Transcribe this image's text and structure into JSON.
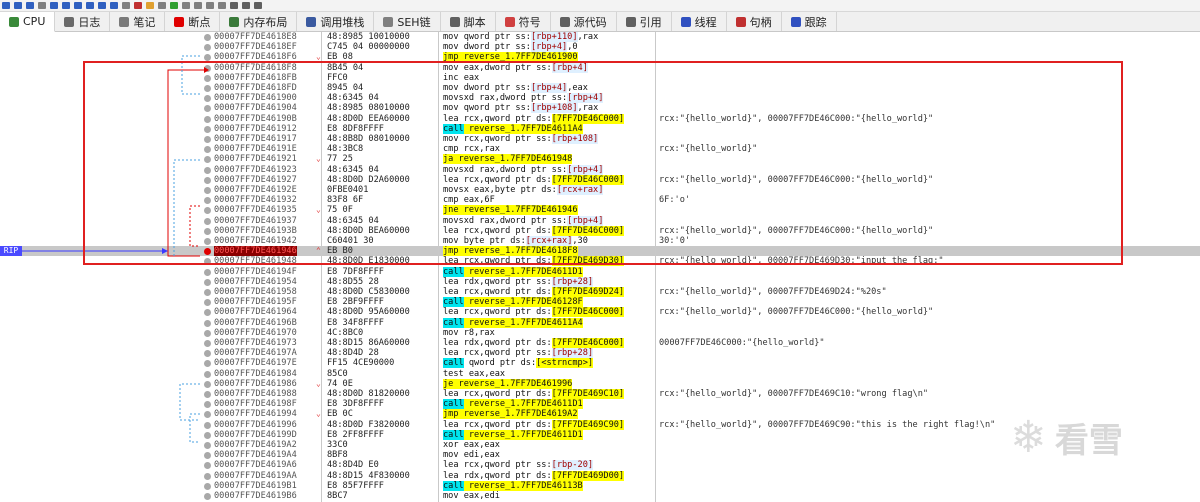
{
  "tabs": [
    {
      "label": "CPU",
      "icon": "cpu-icon",
      "active": true,
      "color": "#3a8a3a"
    },
    {
      "label": "日志",
      "icon": "log-icon",
      "active": false,
      "color": "#6a6a6a"
    },
    {
      "label": "笔记",
      "icon": "notes-icon",
      "active": false,
      "color": "#7a7a7a"
    },
    {
      "label": "断点",
      "icon": "breakpoint-icon",
      "active": false,
      "color": "#e00000"
    },
    {
      "label": "内存布局",
      "icon": "memory-map-icon",
      "active": false,
      "color": "#3a7a3a"
    },
    {
      "label": "调用堆栈",
      "icon": "call-stack-icon",
      "active": false,
      "color": "#3a5aa0"
    },
    {
      "label": "SEH链",
      "icon": "seh-icon",
      "active": false,
      "color": "#808080"
    },
    {
      "label": "脚本",
      "icon": "script-icon",
      "active": false,
      "color": "#606060"
    },
    {
      "label": "符号",
      "icon": "symbol-icon",
      "active": false,
      "color": "#d04040"
    },
    {
      "label": "源代码",
      "icon": "source-icon",
      "active": false,
      "color": "#606060"
    },
    {
      "label": "引用",
      "icon": "reference-icon",
      "active": false,
      "color": "#606060"
    },
    {
      "label": "线程",
      "icon": "thread-icon",
      "active": false,
      "color": "#3050c0"
    },
    {
      "label": "句柄",
      "icon": "handle-icon",
      "active": false,
      "color": "#c03030"
    },
    {
      "label": "跟踪",
      "icon": "trace-icon",
      "active": false,
      "color": "#3050c0"
    }
  ],
  "rip_label": "RIP",
  "watermark": "看雪",
  "rows": [
    {
      "addr": "00007FF7DE4618E8",
      "bytes": "48:8985 10010000",
      "instr": [
        {
          "t": "mov qword ptr ss:"
        },
        {
          "t": "[rbp+110]",
          "c": "mem"
        },
        {
          "t": ",rax"
        }
      ],
      "comment": ""
    },
    {
      "addr": "00007FF7DE4618EF",
      "bytes": "C745 04 00000000",
      "instr": [
        {
          "t": "mov dword ptr ss:"
        },
        {
          "t": "[rbp+4]",
          "c": "mem"
        },
        {
          "t": ",0"
        }
      ],
      "comment": ""
    },
    {
      "addr": "00007FF7DE4618F6",
      "bytes": "EB 08",
      "arrow": "v",
      "instr": [
        {
          "t": "jmp reverse_1.7FF7DE461900",
          "c": "hl-y"
        }
      ],
      "comment": ""
    },
    {
      "addr": "00007FF7DE4618F8",
      "bytes": "8B45 04",
      "instr": [
        {
          "t": "mov eax,dword ptr ss:"
        },
        {
          "t": "[rbp+4]",
          "c": "mem"
        }
      ],
      "comment": ""
    },
    {
      "addr": "00007FF7DE4618FB",
      "bytes": "FFC0",
      "instr": [
        {
          "t": "inc eax"
        }
      ],
      "comment": ""
    },
    {
      "addr": "00007FF7DE4618FD",
      "bytes": "8945 04",
      "instr": [
        {
          "t": "mov dword ptr ss:"
        },
        {
          "t": "[rbp+4]",
          "c": "mem"
        },
        {
          "t": ",eax"
        }
      ],
      "comment": ""
    },
    {
      "addr": "00007FF7DE461900",
      "bytes": "48:6345 04",
      "instr": [
        {
          "t": "movsxd rax,dword ptr ss:"
        },
        {
          "t": "[rbp+4]",
          "c": "mem"
        }
      ],
      "comment": ""
    },
    {
      "addr": "00007FF7DE461904",
      "bytes": "48:8985 08010000",
      "instr": [
        {
          "t": "mov qword ptr ss:"
        },
        {
          "t": "[rbp+108]",
          "c": "mem"
        },
        {
          "t": ",rax"
        }
      ],
      "comment": ""
    },
    {
      "addr": "00007FF7DE46190B",
      "bytes": "48:8D0D EEA60000",
      "instr": [
        {
          "t": "lea rcx,qword ptr ds:"
        },
        {
          "t": "[7FF7DE46C000]",
          "c": "hl-y"
        }
      ],
      "comment": "rcx:\"{hello_world}\", 00007FF7DE46C000:\"{hello_world}\""
    },
    {
      "addr": "00007FF7DE461912",
      "bytes": "E8 8DF8FFFF",
      "instr": [
        {
          "t": "call",
          "c": "hl-c"
        },
        {
          "t": " reverse_1.7FF7DE4611A4",
          "c": "hl-y"
        }
      ],
      "comment": ""
    },
    {
      "addr": "00007FF7DE461917",
      "bytes": "48:8B8D 08010000",
      "instr": [
        {
          "t": "mov rcx,qword ptr ss:"
        },
        {
          "t": "[rbp+108]",
          "c": "mem"
        }
      ],
      "comment": ""
    },
    {
      "addr": "00007FF7DE46191E",
      "bytes": "48:3BC8",
      "instr": [
        {
          "t": "cmp rcx,rax"
        }
      ],
      "comment": "rcx:\"{hello_world}\""
    },
    {
      "addr": "00007FF7DE461921",
      "bytes": "77 25",
      "arrow": "v",
      "instr": [
        {
          "t": "ja reverse_1.7FF7DE461948",
          "c": "hl-y"
        }
      ],
      "comment": ""
    },
    {
      "addr": "00007FF7DE461923",
      "bytes": "48:6345 04",
      "instr": [
        {
          "t": "movsxd rax,dword ptr ss:"
        },
        {
          "t": "[rbp+4]",
          "c": "mem"
        }
      ],
      "comment": ""
    },
    {
      "addr": "00007FF7DE461927",
      "bytes": "48:8D0D D2A60000",
      "instr": [
        {
          "t": "lea rcx,qword ptr ds:"
        },
        {
          "t": "[7FF7DE46C000]",
          "c": "hl-y"
        }
      ],
      "comment": "rcx:\"{hello_world}\", 00007FF7DE46C000:\"{hello_world}\""
    },
    {
      "addr": "00007FF7DE46192E",
      "bytes": "0FBE0401",
      "instr": [
        {
          "t": "movsx eax,byte ptr ds:"
        },
        {
          "t": "[rcx+rax]",
          "c": "mem"
        }
      ],
      "comment": ""
    },
    {
      "addr": "00007FF7DE461932",
      "bytes": "83F8 6F",
      "instr": [
        {
          "t": "cmp eax,6F"
        }
      ],
      "comment": "6F:'o'"
    },
    {
      "addr": "00007FF7DE461935",
      "bytes": "75 0F",
      "arrow": "v",
      "instr": [
        {
          "t": "jne reverse_1.7FF7DE461946",
          "c": "hl-y"
        }
      ],
      "comment": ""
    },
    {
      "addr": "00007FF7DE461937",
      "bytes": "48:6345 04",
      "instr": [
        {
          "t": "movsxd rax,dword ptr ss:"
        },
        {
          "t": "[rbp+4]",
          "c": "mem"
        }
      ],
      "comment": ""
    },
    {
      "addr": "00007FF7DE46193B",
      "bytes": "48:8D0D BEA60000",
      "instr": [
        {
          "t": "lea rcx,qword ptr ds:"
        },
        {
          "t": "[7FF7DE46C000]",
          "c": "hl-y"
        }
      ],
      "comment": "rcx:\"{hello_world}\", 00007FF7DE46C000:\"{hello_world}\""
    },
    {
      "addr": "00007FF7DE461942",
      "bytes": "C60401 30",
      "instr": [
        {
          "t": "mov byte ptr ds:"
        },
        {
          "t": "[rcx+rax]",
          "c": "mem"
        },
        {
          "t": ",30"
        }
      ],
      "comment": "30:'0'"
    },
    {
      "addr": "00007FF7DE461946",
      "bytes": "EB B0",
      "rip": true,
      "bp": true,
      "arrow": "^",
      "instr": [
        {
          "t": "jmp reverse_1.7FF7DE4618F8",
          "c": "hl-y"
        }
      ],
      "comment": ""
    },
    {
      "addr": "00007FF7DE461948",
      "bytes": "48:8D0D E1830000",
      "instr": [
        {
          "t": "lea rcx,qword ptr ds:"
        },
        {
          "t": "[7FF7DE469D30]",
          "c": "hl-y"
        }
      ],
      "comment": "rcx:\"{hello_world}\", 00007FF7DE469D30:\"input the flag:\""
    },
    {
      "addr": "00007FF7DE46194F",
      "bytes": "E8 7DF8FFFF",
      "instr": [
        {
          "t": "call",
          "c": "hl-c"
        },
        {
          "t": " reverse_1.7FF7DE4611D1",
          "c": "hl-y"
        }
      ],
      "comment": ""
    },
    {
      "addr": "00007FF7DE461954",
      "bytes": "48:8D55 28",
      "instr": [
        {
          "t": "lea rdx,qword ptr ss:"
        },
        {
          "t": "[rbp+28]",
          "c": "mem"
        }
      ],
      "comment": ""
    },
    {
      "addr": "00007FF7DE461958",
      "bytes": "48:8D0D C5830000",
      "instr": [
        {
          "t": "lea rcx,qword ptr ds:"
        },
        {
          "t": "[7FF7DE469D24]",
          "c": "hl-y"
        }
      ],
      "comment": "rcx:\"{hello_world}\", 00007FF7DE469D24:\"%20s\""
    },
    {
      "addr": "00007FF7DE46195F",
      "bytes": "E8 2BF9FFFF",
      "instr": [
        {
          "t": "call",
          "c": "hl-c"
        },
        {
          "t": " reverse_1.7FF7DE46128F",
          "c": "hl-y"
        }
      ],
      "comment": ""
    },
    {
      "addr": "00007FF7DE461964",
      "bytes": "48:8D0D 95A60000",
      "instr": [
        {
          "t": "lea rcx,qword ptr ds:"
        },
        {
          "t": "[7FF7DE46C000]",
          "c": "hl-y"
        }
      ],
      "comment": "rcx:\"{hello_world}\", 00007FF7DE46C000:\"{hello_world}\""
    },
    {
      "addr": "00007FF7DE46196B",
      "bytes": "E8 34F8FFFF",
      "instr": [
        {
          "t": "call",
          "c": "hl-c"
        },
        {
          "t": " reverse_1.7FF7DE4611A4",
          "c": "hl-y"
        }
      ],
      "comment": ""
    },
    {
      "addr": "00007FF7DE461970",
      "bytes": "4C:8BC0",
      "instr": [
        {
          "t": "mov r8,rax"
        }
      ],
      "comment": ""
    },
    {
      "addr": "00007FF7DE461973",
      "bytes": "48:8D15 86A60000",
      "instr": [
        {
          "t": "lea rdx,qword ptr ds:"
        },
        {
          "t": "[7FF7DE46C000]",
          "c": "hl-y"
        }
      ],
      "comment": "00007FF7DE46C000:\"{hello_world}\""
    },
    {
      "addr": "00007FF7DE46197A",
      "bytes": "48:8D4D 28",
      "instr": [
        {
          "t": "lea rcx,qword ptr ss:"
        },
        {
          "t": "[rbp+28]",
          "c": "mem"
        }
      ],
      "comment": ""
    },
    {
      "addr": "00007FF7DE46197E",
      "bytes": "FF15 4CE90000",
      "instr": [
        {
          "t": "call",
          "c": "hl-c"
        },
        {
          "t": " qword ptr ds:"
        },
        {
          "t": "[<strncmp>]",
          "c": "hl-y"
        }
      ],
      "comment": ""
    },
    {
      "addr": "00007FF7DE461984",
      "bytes": "85C0",
      "instr": [
        {
          "t": "test eax,eax"
        }
      ],
      "comment": ""
    },
    {
      "addr": "00007FF7DE461986",
      "bytes": "74 0E",
      "arrow": "v",
      "instr": [
        {
          "t": "je reverse_1.7FF7DE461996",
          "c": "hl-y"
        }
      ],
      "comment": ""
    },
    {
      "addr": "00007FF7DE461988",
      "bytes": "48:8D0D 81820000",
      "instr": [
        {
          "t": "lea rcx,qword ptr ds:"
        },
        {
          "t": "[7FF7DE469C10]",
          "c": "hl-y"
        }
      ],
      "comment": "rcx:\"{hello_world}\", 00007FF7DE469C10:\"wrong flag\\n\""
    },
    {
      "addr": "00007FF7DE46198F",
      "bytes": "E8 3DF8FFFF",
      "instr": [
        {
          "t": "call",
          "c": "hl-c"
        },
        {
          "t": " reverse_1.7FF7DE4611D1",
          "c": "hl-y"
        }
      ],
      "comment": ""
    },
    {
      "addr": "00007FF7DE461994",
      "bytes": "EB 0C",
      "arrow": "v",
      "instr": [
        {
          "t": "jmp reverse_1.7FF7DE4619A2",
          "c": "hl-y"
        }
      ],
      "comment": ""
    },
    {
      "addr": "00007FF7DE461996",
      "bytes": "48:8D0D F3820000",
      "instr": [
        {
          "t": "lea rcx,qword ptr ds:"
        },
        {
          "t": "[7FF7DE469C90]",
          "c": "hl-y"
        }
      ],
      "comment": "rcx:\"{hello_world}\", 00007FF7DE469C90:\"this is the right flag!\\n\""
    },
    {
      "addr": "00007FF7DE46199D",
      "bytes": "E8 2FF8FFFF",
      "instr": [
        {
          "t": "call",
          "c": "hl-c"
        },
        {
          "t": " reverse_1.7FF7DE4611D1",
          "c": "hl-y"
        }
      ],
      "comment": ""
    },
    {
      "addr": "00007FF7DE4619A2",
      "bytes": "33C0",
      "instr": [
        {
          "t": "xor eax,eax"
        }
      ],
      "comment": ""
    },
    {
      "addr": "00007FF7DE4619A4",
      "bytes": "8BF8",
      "instr": [
        {
          "t": "mov edi,eax"
        }
      ],
      "comment": ""
    },
    {
      "addr": "00007FF7DE4619A6",
      "bytes": "48:8D4D E0",
      "instr": [
        {
          "t": "lea rcx,qword ptr ss:"
        },
        {
          "t": "[rbp-20]",
          "c": "mem"
        }
      ],
      "comment": ""
    },
    {
      "addr": "00007FF7DE4619AA",
      "bytes": "48:8D15 4F830000",
      "instr": [
        {
          "t": "lea rdx,qword ptr ds:"
        },
        {
          "t": "[7FF7DE469D00]",
          "c": "hl-y"
        }
      ],
      "comment": ""
    },
    {
      "addr": "00007FF7DE4619B1",
      "bytes": "E8 85F7FFFF",
      "instr": [
        {
          "t": "call",
          "c": "hl-c"
        },
        {
          "t": " reverse_1.7FF7DE46113B",
          "c": "hl-y"
        }
      ],
      "comment": ""
    },
    {
      "addr": "00007FF7DE4619B6",
      "bytes": "8BC7",
      "instr": [
        {
          "t": "mov eax,edi"
        }
      ],
      "comment": ""
    }
  ]
}
